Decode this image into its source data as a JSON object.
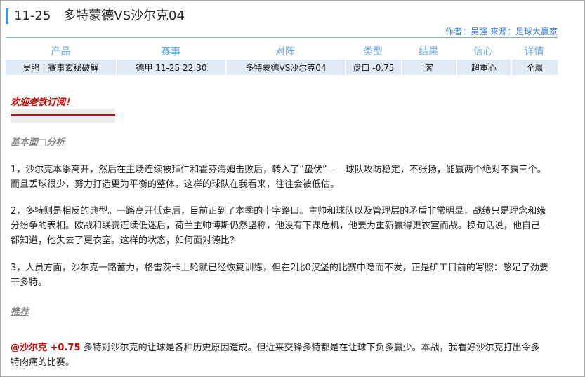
{
  "header": {
    "date": "11-25",
    "match": "多特蒙德VS沙尔克04",
    "meta": "作者：吴强  来源：足球大赢家"
  },
  "table": {
    "headers": [
      "产品",
      "赛事",
      "对阵",
      "类型",
      "结果",
      "信心",
      "详情"
    ],
    "row": [
      "吴强 | 赛事玄秘破解",
      "德甲 11-25 22:30",
      "多特蒙德VS沙尔克04",
      "盘口 -0.75",
      "客",
      "超重心",
      "全赢"
    ]
  },
  "welcome": "欢迎老铁订阅！",
  "sections": {
    "analysis_title": "基本面□分析",
    "recommend_title": "推荐"
  },
  "paragraphs": {
    "p1": "1，沙尔克本季高开，然后在主场连续被拜仁和霍芬海姆击败后，转入了“蛰伏”——球队攻防稳定，不张扬，能赢两个绝对不赢三个。而且丢球很少，努力打造更为平衡的整体。这样的球队在我看来，往往会被低估。",
    "p2": "2，多特则是相反的典型。一路高开低走后，目前正到了本季的十字路口。主帅和球队以及管理层的矛盾非常明显，战绩只是理念和缘分纷争的表相。欧战和联赛连续低迷后，荷兰主帅博斯仍然坚称，他没有下课危机，他要为重新赢得更衣室而战。换句话说，他自己都知道，他失去了更衣室。这样的状态，如何面对德比？",
    "p3": "3，人员方面，沙尔克一路蓄力，格雷茨卡上轮就已经恢复训练，但在2比0汉堡的比赛中隐而不发，正是矿工目前的写照：憋足了劲要干多特。",
    "pick_team": "@沙尔克 +0.75",
    "pick_text": " 多特对沙尔克的让球是各种历史原因造成。但近来交锋多特都是在让球下负多赢少。本战，我看好沙尔克打出令多特肉痛的比赛。"
  },
  "colors": {
    "accent": "#4a90e2",
    "header_text": "#64a7e8",
    "row_bg": "#dfeaf7",
    "red": "#d60000"
  }
}
